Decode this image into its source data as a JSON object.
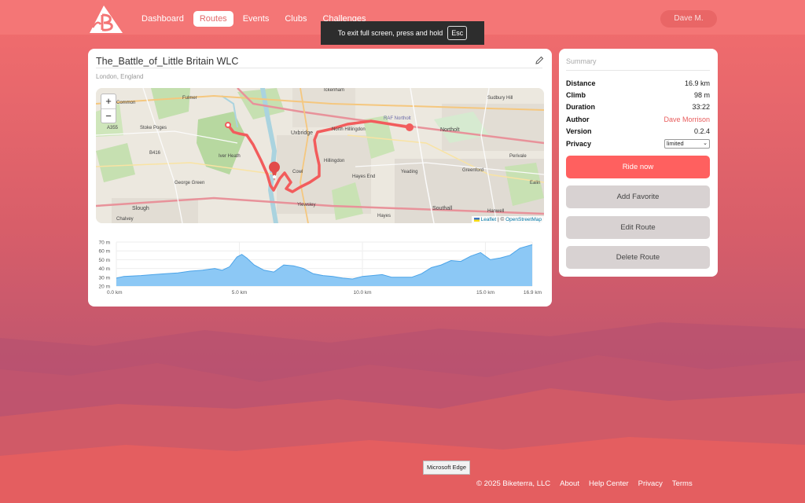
{
  "nav": {
    "items": [
      {
        "label": "Dashboard"
      },
      {
        "label": "Routes",
        "active": true
      },
      {
        "label": "Events"
      },
      {
        "label": "Clubs"
      },
      {
        "label": "Challenges"
      }
    ],
    "user": "Dave M."
  },
  "fullscreen": {
    "message": "To exit full screen, press and hold",
    "key": "Esc"
  },
  "route": {
    "title": "The_Battle_of_Little Britain WLC",
    "location": "London, England"
  },
  "map": {
    "zoom_in": "+",
    "zoom_out": "−",
    "attribution_leaflet": "Leaflet",
    "attribution_sep": " | © ",
    "attribution_osm": "OpenStreetMap",
    "labels": {
      "fulmer": "Fulmer",
      "farnham_common": "Common",
      "a355": "A355",
      "stoke_poges": "Stoke Poges",
      "b416": "B416",
      "iver_heath": "Iver Heath",
      "george_green": "George Green",
      "slough": "Slough",
      "chalvey": "Chalvey",
      "uxbridge": "Uxbridge",
      "ickenham": "Ickenham",
      "north_hillingdon": "North Hillingdon",
      "raf_northolt": "RAF Northolt",
      "northolt": "Northolt",
      "sudbury_hill": "Sudbury Hill",
      "hillingdon": "Hillingdon",
      "hayes_end": "Hayes End",
      "yeading": "Yeading",
      "greenford": "Greenford",
      "perivale": "Perivale",
      "cowley": "Cowl",
      "yiewsley": "Yiewsley",
      "southall": "Southall",
      "hayes": "Hayes",
      "hanwell": "Hanwell",
      "ealing": "Ealin"
    }
  },
  "colors": {
    "accent": "#ff605f",
    "route_line": "#f25c5c",
    "elevation_fill": "#8cc8f5",
    "elevation_stroke": "#4aa3e8"
  },
  "elevation": {
    "y_ticks": [
      "70 m",
      "60 m",
      "50 m",
      "40 m",
      "30 m",
      "20 m"
    ],
    "x_ticks": [
      "0.0 km",
      "5.0 km",
      "10.0 km",
      "15.0 km",
      "16.9 km"
    ],
    "x_values": [
      0,
      5,
      10,
      15,
      16.9
    ],
    "y_range": [
      20,
      70
    ],
    "x_range": [
      0,
      16.9
    ],
    "profile_km": [
      0,
      0.3,
      1.0,
      1.5,
      2.0,
      2.5,
      3.0,
      3.5,
      4.0,
      4.3,
      4.6,
      4.9,
      5.1,
      5.3,
      5.6,
      6.0,
      6.4,
      6.8,
      7.2,
      7.6,
      8.0,
      8.4,
      8.8,
      9.2,
      9.6,
      10.0,
      10.4,
      10.8,
      11.2,
      11.6,
      12.0,
      12.4,
      12.8,
      13.2,
      13.6,
      14.0,
      14.4,
      14.8,
      15.2,
      15.6,
      16.0,
      16.4,
      16.9
    ],
    "profile_m": [
      29,
      31,
      32,
      33,
      34,
      35,
      37,
      38,
      40,
      38,
      42,
      53,
      56,
      52,
      44,
      38,
      36,
      44,
      43,
      40,
      34,
      32,
      31,
      29,
      28,
      31,
      32,
      33,
      30,
      30,
      30,
      34,
      41,
      44,
      49,
      48,
      54,
      58,
      50,
      52,
      55,
      63,
      67
    ]
  },
  "summary": {
    "heading": "Summary",
    "rows": [
      {
        "key": "Distance",
        "value": "16.9 km"
      },
      {
        "key": "Climb",
        "value": "98 m"
      },
      {
        "key": "Duration",
        "value": "33:22"
      },
      {
        "key": "Author",
        "value": "Dave Morrison"
      },
      {
        "key": "Version",
        "value": "0.2.4"
      },
      {
        "key": "Privacy",
        "value": "limited"
      }
    ],
    "buttons": {
      "ride_now": "Ride now",
      "add_favorite": "Add Favorite",
      "edit_route": "Edit Route",
      "delete_route": "Delete Route"
    }
  },
  "tooltip": "Microsoft Edge",
  "footer": {
    "copyright": "© 2025 Biketerra, LLC",
    "about": "About",
    "help": "Help Center",
    "privacy": "Privacy",
    "terms": "Terms"
  }
}
